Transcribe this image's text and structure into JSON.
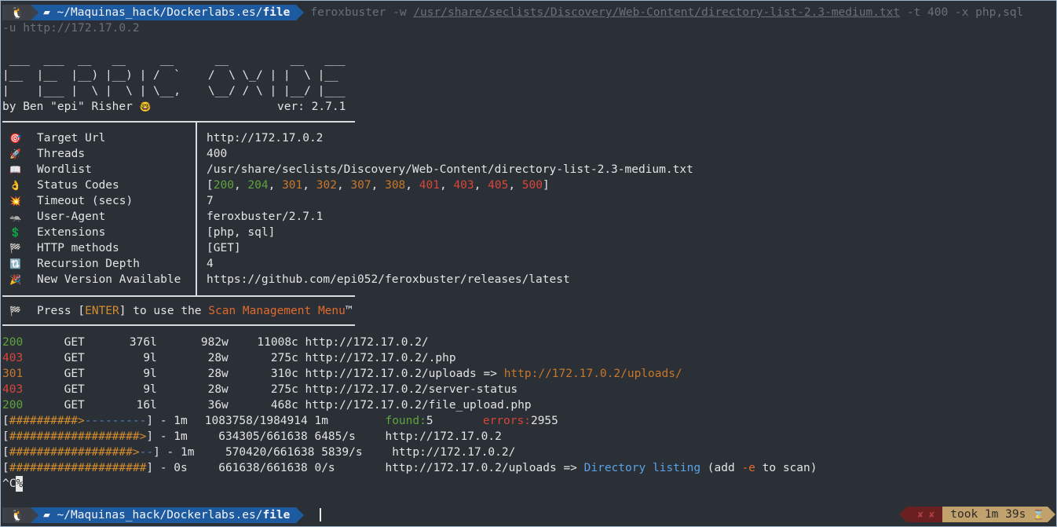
{
  "prompt": {
    "os_icon": "linux-tux-icon",
    "folder_icon": "folder-icon",
    "path_prefix": "~/Maquinas_hack/Dockerlabs.es/",
    "path_last": "file"
  },
  "command": {
    "line1_pre": "feroxbuster -w ",
    "line1_wordlist": "/usr/share/seclists/Discovery/Web-Content/directory-list-2.3-medium.txt",
    "line1_post": " -t 400 -x php,sql",
    "line2": "-u http://172.17.0.2"
  },
  "banner": {
    "art1": " ___  ___  __   __     __      __         __   ___",
    "art2": "|__  |__  |__) |__) | /  `    /  \\ \\_/ | |  \\ |__",
    "art3": "|    |___ |  \\ |  \\ | \\__,    \\__/ / \\ | |__/ |___",
    "byline": "by Ben \"epi\" Risher",
    "byline_emoji": "🤓",
    "version": "ver: 2.7.1"
  },
  "config": [
    {
      "icon": "🎯",
      "icon_name": "target-icon",
      "label": "Target Url",
      "value": "http://172.17.0.2"
    },
    {
      "icon": "🚀",
      "icon_name": "rocket-icon",
      "label": "Threads",
      "value": "400"
    },
    {
      "icon": "📖",
      "icon_name": "book-icon",
      "label": "Wordlist",
      "value": "/usr/share/seclists/Discovery/Web-Content/directory-list-2.3-medium.txt"
    },
    {
      "icon": "👌",
      "icon_name": "ok-hand-icon",
      "label": "Status Codes",
      "value": ""
    },
    {
      "icon": "💥",
      "icon_name": "collision-icon",
      "label": "Timeout (secs)",
      "value": "7"
    },
    {
      "icon": "🦡",
      "icon_name": "badger-icon",
      "label": "User-Agent",
      "value": "feroxbuster/2.7.1"
    },
    {
      "icon": "💲",
      "icon_name": "dollar-icon",
      "label": "Extensions",
      "value": "[php, sql]"
    },
    {
      "icon": "🏁",
      "icon_name": "checkered-flag-icon",
      "label": "HTTP methods",
      "value": "[GET]"
    },
    {
      "icon": "🔃",
      "icon_name": "recursion-arrows-icon",
      "label": "Recursion Depth",
      "value": "4"
    },
    {
      "icon": "🎉",
      "icon_name": "party-popper-icon",
      "label": "New Version Available",
      "value": "https://github.com/epi052/feroxbuster/releases/latest"
    }
  ],
  "status_codes": [
    "200",
    "204",
    "301",
    "302",
    "307",
    "308",
    "401",
    "403",
    "405",
    "500"
  ],
  "press": {
    "icon": "🏁",
    "pre": "Press [",
    "key": "ENTER",
    "mid": "] to use the ",
    "menu": "Scan Management Menu",
    "tm": "™"
  },
  "results": [
    {
      "code": "200",
      "method": "GET",
      "lines": "376l",
      "words": "982w",
      "chars": "11008c",
      "url": "http://172.17.0.2/",
      "redirect": ""
    },
    {
      "code": "403",
      "method": "GET",
      "lines": "9l",
      "words": "28w",
      "chars": "275c",
      "url": "http://172.17.0.2/.php",
      "redirect": ""
    },
    {
      "code": "301",
      "method": "GET",
      "lines": "9l",
      "words": "28w",
      "chars": "310c",
      "url": "http://172.17.0.2/uploads => ",
      "redirect": "http://172.17.0.2/uploads/"
    },
    {
      "code": "403",
      "method": "GET",
      "lines": "9l",
      "words": "28w",
      "chars": "275c",
      "url": "http://172.17.0.2/server-status",
      "redirect": ""
    },
    {
      "code": "200",
      "method": "GET",
      "lines": "16l",
      "words": "36w",
      "chars": "468c",
      "url": "http://172.17.0.2/file_upload.php",
      "redirect": ""
    }
  ],
  "progress": [
    {
      "done": "##########>",
      "todo": "---------",
      "time": "- 1m",
      "count": "1083758/1984914",
      "rate": "1m",
      "extra_label1": "found:",
      "extra_val1": "5",
      "extra_label2": "errors:",
      "extra_val2": "2955",
      "url": ""
    },
    {
      "done": "###################>",
      "todo": "",
      "time": "- 1m",
      "count": "634305/661638",
      "rate": "6485/s",
      "url": "http://172.17.0.2"
    },
    {
      "done": "##################>",
      "todo": "--",
      "time": "- 1m",
      "count": "570420/661638",
      "rate": "5839/s",
      "url": "http://172.17.0.2/"
    },
    {
      "done": "####################",
      "todo": "",
      "time": "- 0s",
      "count": "661638/661638",
      "rate": "0/s",
      "url": "http://172.17.0.2/uploads => "
    }
  ],
  "dir_listing": {
    "text": "Directory listing",
    "pre": " (add ",
    "flag": "-e",
    "post": " to scan)"
  },
  "interrupt": "^C",
  "interrupt_cursor": "%",
  "rprompt": {
    "x_label": "✘ ✘",
    "took": "took 1m 39s",
    "hourglass": "⌛"
  }
}
